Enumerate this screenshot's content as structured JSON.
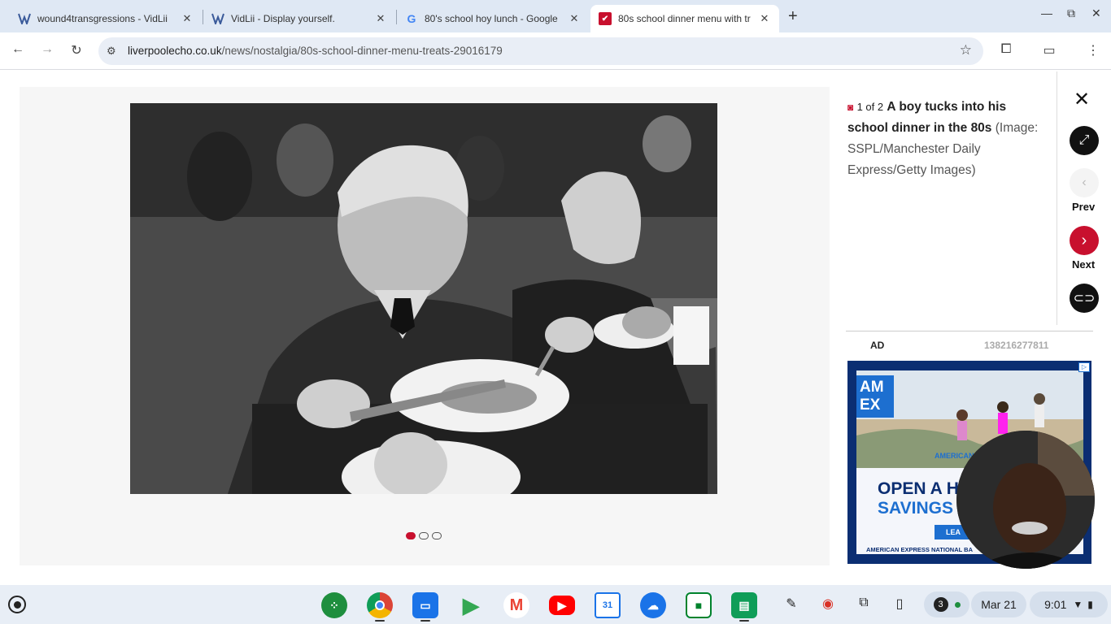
{
  "browser": {
    "tabs": [
      {
        "title": "wound4transgressions - VidLii",
        "favicon": "vidlii-icon",
        "active": false
      },
      {
        "title": "VidLii - Display yourself.",
        "favicon": "vidlii-icon",
        "active": false
      },
      {
        "title": "80's school hoy lunch - Google",
        "favicon": "google-icon",
        "active": false
      },
      {
        "title": "80s school dinner menu with tr",
        "favicon": "liverpool-echo-icon",
        "active": true
      }
    ],
    "url_domain": "liverpoolecho.co.uk",
    "url_path": "/news/nostalgia/80s-school-dinner-menu-treats-29016179"
  },
  "gallery": {
    "counter": "1 of 2",
    "caption_title": "A boy tucks into his school dinner in the 80s",
    "caption_credit": "(Image: SSPL/Manchester Daily Express/Getty Images)",
    "prev_label": "Prev",
    "next_label": "Next",
    "dots": 3,
    "active_dot": 0
  },
  "ad": {
    "label": "AD",
    "id": "138216277811",
    "brand": "AM EX",
    "headline_1": "OPEN A H",
    "headline_2": "SAVINGS",
    "cta": "LEA",
    "banner_text": "AMERICAN",
    "footer": "AMERICAN EXPRESS NATIONAL BA"
  },
  "shelf": {
    "notification_count": "3",
    "date": "Mar 21",
    "time": "9:01"
  },
  "colors": {
    "accent_red": "#c8102e",
    "amex_blue": "#1d6fd0",
    "amex_navy": "#0b2e72"
  }
}
